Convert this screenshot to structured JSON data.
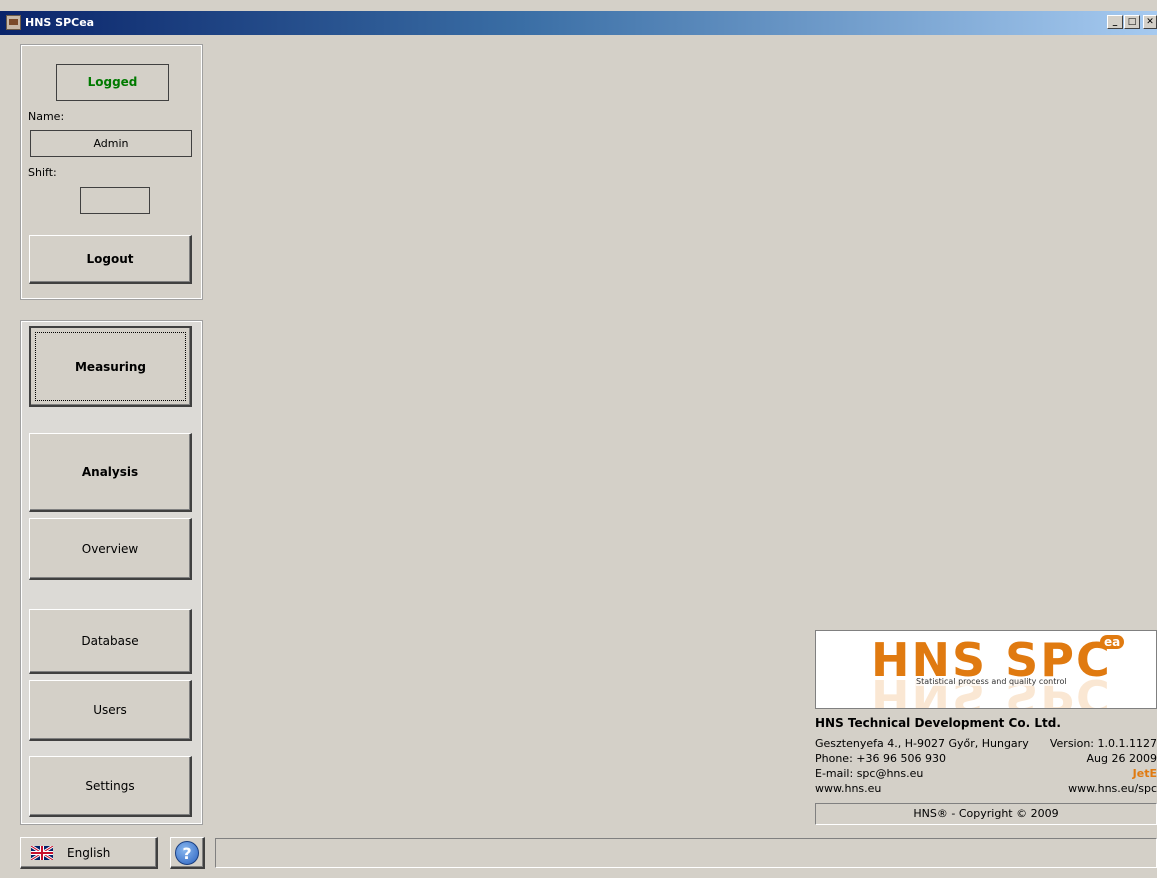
{
  "window": {
    "title": "HNS SPCea",
    "min": "_",
    "max": "□",
    "close": "✕"
  },
  "login": {
    "status": "Logged",
    "status_color": "#007a00",
    "name_label": "Name:",
    "name_value": "Admin",
    "shift_label": "Shift:",
    "shift_value": "",
    "logout_label": "Logout"
  },
  "nav": {
    "measuring": "Measuring",
    "analysis": "Analysis",
    "overview": "Overview",
    "database": "Database",
    "users": "Users",
    "settings": "Settings"
  },
  "footer": {
    "language": "English",
    "help_icon": "?",
    "status_text": ""
  },
  "about": {
    "logo_text": "HNS SPC",
    "logo_sup": "ea",
    "logo_tagline": "Statistical process and quality control",
    "company": "HNS Technical Development Co. Ltd.",
    "address": "Gesztenyefa 4., H-9027 Győr, Hungary",
    "phone": "Phone: +36 96 506 930",
    "email": "E-mail: spc@hns.eu",
    "web": "www.hns.eu",
    "version": "Version: 1.0.1.1127",
    "date": "Aug 26 2009",
    "edition": "JetE",
    "web_spc": "www.hns.eu/spc",
    "copyright": "HNS® - Copyright © 2009",
    "accent": "#e07a10"
  }
}
